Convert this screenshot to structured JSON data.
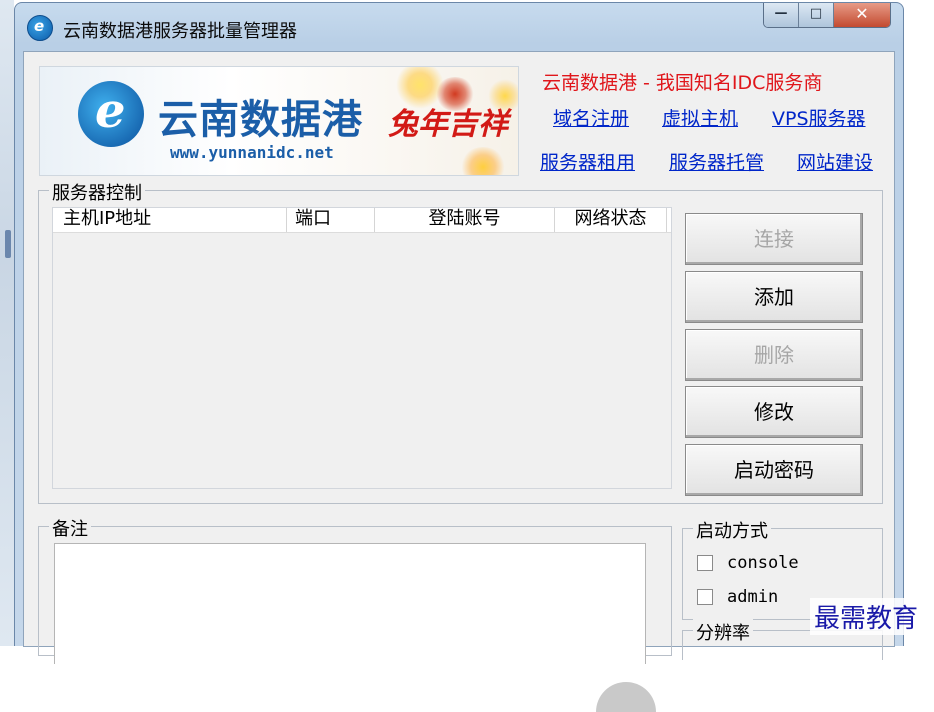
{
  "window": {
    "title": "云南数据港服务器批量管理器",
    "controls": {
      "minimize": "—",
      "maximize": "□",
      "close": "✕"
    }
  },
  "banner": {
    "logo_text": "云南数据港",
    "logo_url": "www.yunnanidc.net",
    "festive_text": "兔年吉祥"
  },
  "links": {
    "tagline": "云南数据港 - 我国知名IDC服务商",
    "items": [
      "域名注册",
      "虚拟主机",
      "VPS服务器",
      "服务器租用",
      "服务器托管",
      "网站建设"
    ]
  },
  "server_control": {
    "title": "服务器控制",
    "columns": [
      "主机IP地址",
      "端口",
      "登陆账号",
      "网络状态"
    ],
    "rows": []
  },
  "buttons": {
    "connect": "连接",
    "add": "添加",
    "delete": "删除",
    "modify": "修改",
    "start_password": "启动密码"
  },
  "notes": {
    "title": "备注",
    "value": ""
  },
  "start_mode": {
    "title": "启动方式",
    "options": [
      {
        "label": "console",
        "checked": false
      },
      {
        "label": "admin",
        "checked": false
      }
    ]
  },
  "resolution": {
    "title": "分辨率"
  },
  "watermark": "最需教育"
}
